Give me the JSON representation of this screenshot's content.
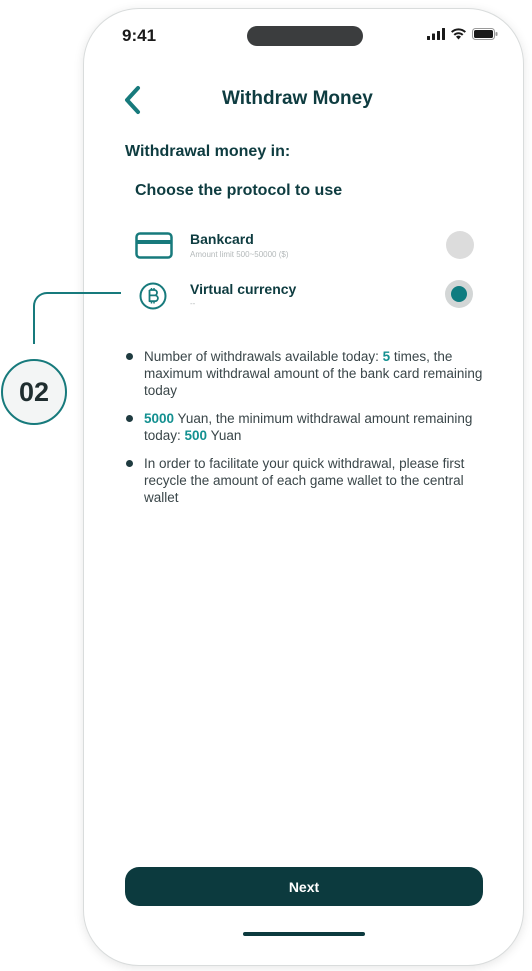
{
  "status_bar": {
    "time": "9:41",
    "icons": [
      "signal-icon",
      "wifi-icon",
      "battery-icon"
    ]
  },
  "header": {
    "back_icon": "chevron-left-icon",
    "title": "Withdraw Money"
  },
  "section_label": "Withdrawal money in:",
  "protocol_label": "Choose the protocol to use",
  "options": [
    {
      "icon": "credit-card-icon",
      "title": "Bankcard",
      "subtitle": "Amount limit 500~50000 ($)",
      "selected": false
    },
    {
      "icon": "bitcoin-icon",
      "title": "Virtual currency",
      "subtitle": "--",
      "selected": true
    }
  ],
  "step_badge": "02",
  "notes": {
    "n1_a": "Number of withdrawals available today: ",
    "n1_b": "5",
    "n1_c": " times, the maximum withdrawal amount of the bank card remaining today",
    "n2_a": "5000",
    "n2_b": " Yuan, the minimum withdrawal amount remaining today: ",
    "n2_c": "500",
    "n2_d": " Yuan",
    "n3": "In order to facilitate your quick withdrawal, please first recycle the amount of each game wallet to the central wallet"
  },
  "next_button": "Next",
  "colors": {
    "primary": "#0c3a3e",
    "accent": "#139090",
    "teal_icon": "#177a7c"
  }
}
